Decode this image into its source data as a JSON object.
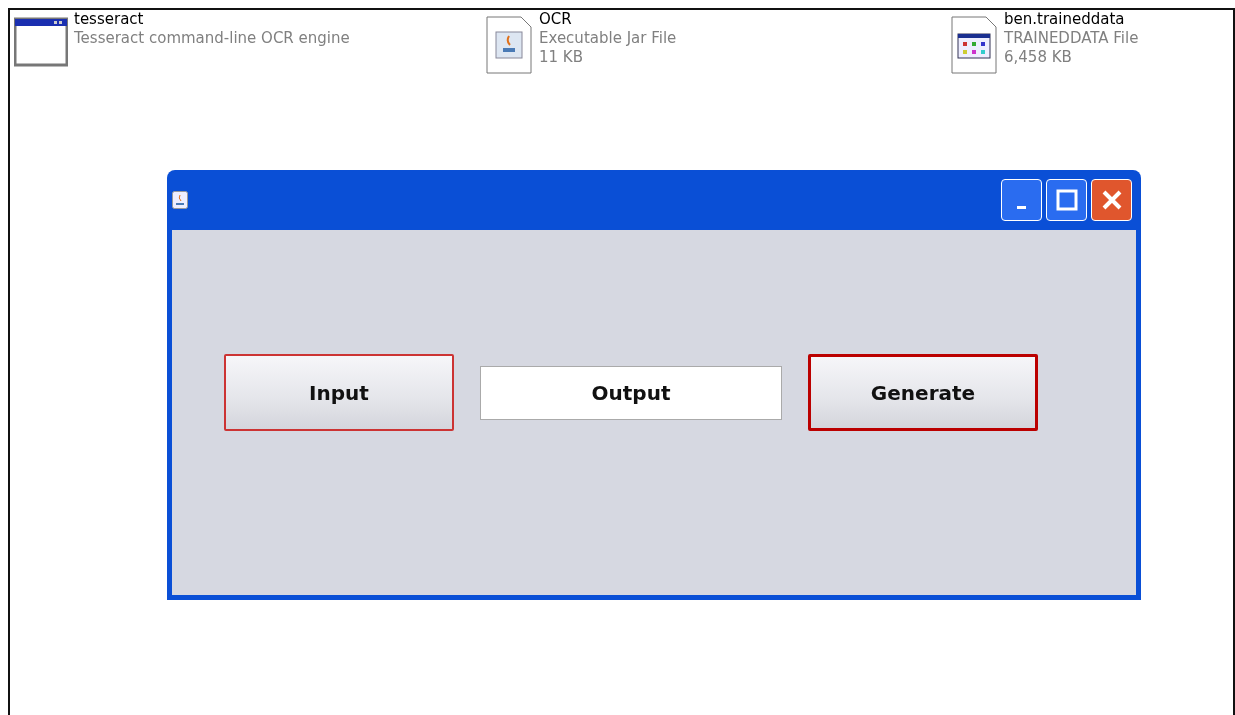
{
  "files": [
    {
      "kind": "app",
      "name": "tesseract",
      "lines": [
        "Tesseract command-line OCR engine"
      ]
    },
    {
      "kind": "jar",
      "name": "OCR",
      "lines": [
        "Executable Jar File",
        "11 KB"
      ]
    },
    {
      "kind": "data",
      "name": "ben.traineddata",
      "lines": [
        "TRAINEDDATA File",
        "6,458 KB"
      ]
    }
  ],
  "window": {
    "buttons": [
      {
        "label": "Input",
        "focused": false
      },
      {
        "label": "Generate",
        "focused": true
      }
    ],
    "output_field": {
      "value": "Output"
    }
  }
}
